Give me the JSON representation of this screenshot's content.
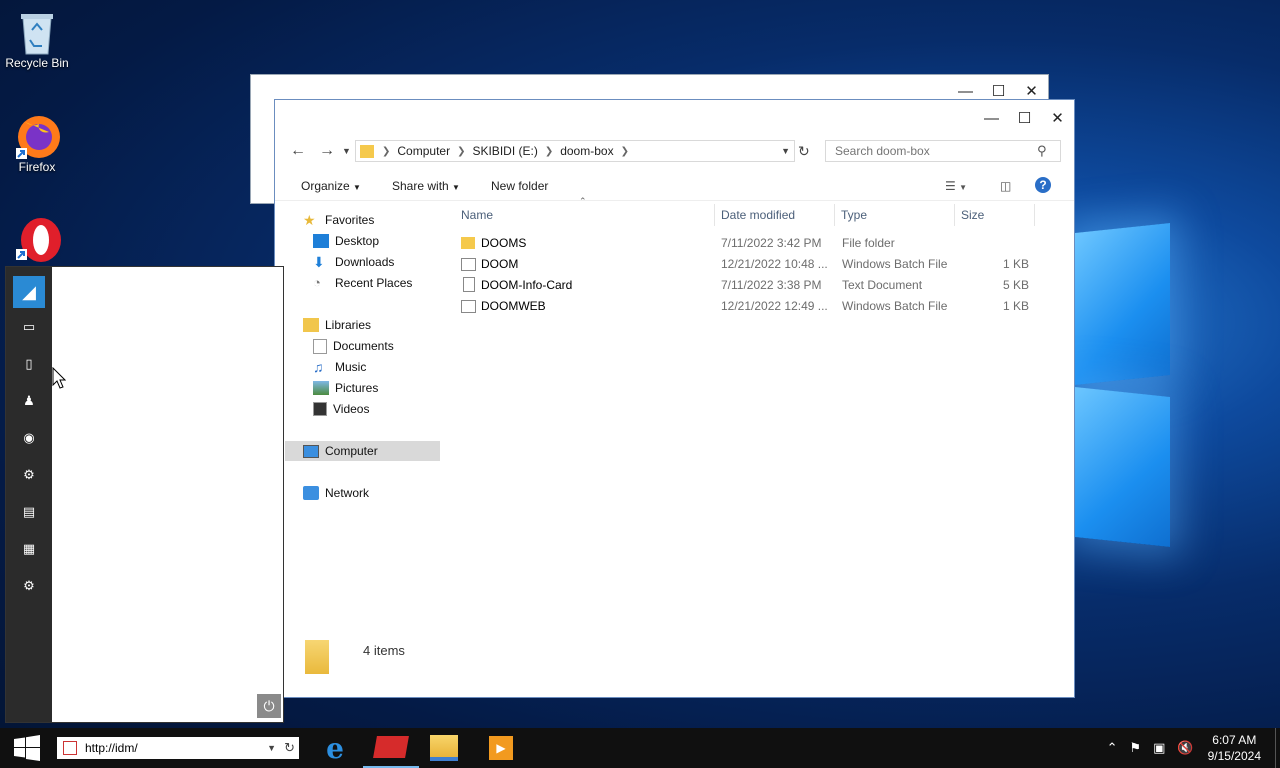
{
  "desktop": {
    "icons": [
      {
        "label": "Recycle Bin",
        "icon": "recycle-bin-icon"
      },
      {
        "label": "Firefox",
        "icon": "firefox-icon"
      },
      {
        "label": "",
        "icon": "opera-icon"
      }
    ]
  },
  "explorer": {
    "address": {
      "crumbs": [
        "Computer",
        "SKIBIDI (E:)",
        "doom-box"
      ]
    },
    "search_placeholder": "Search doom-box",
    "toolbar": {
      "organize": "Organize",
      "share_with": "Share with",
      "new_folder": "New folder"
    },
    "nav": {
      "favorites": "Favorites",
      "desktop": "Desktop",
      "downloads": "Downloads",
      "recent_places": "Recent Places",
      "libraries": "Libraries",
      "documents": "Documents",
      "music": "Music",
      "pictures": "Pictures",
      "videos": "Videos",
      "computer": "Computer",
      "network": "Network"
    },
    "columns": {
      "name": "Name",
      "date": "Date modified",
      "type": "Type",
      "size": "Size"
    },
    "files": [
      {
        "name": "DOOMS",
        "date": "7/11/2022 3:42 PM",
        "type": "File folder",
        "size": "",
        "icon": "folder-icon"
      },
      {
        "name": "DOOM",
        "date": "12/21/2022 10:48 ...",
        "type": "Windows Batch File",
        "size": "1 KB",
        "icon": "batch-file-icon"
      },
      {
        "name": "DOOM-Info-Card",
        "date": "7/11/2022 3:38 PM",
        "type": "Text Document",
        "size": "5 KB",
        "icon": "text-file-icon"
      },
      {
        "name": "DOOMWEB",
        "date": "12/21/2022 12:49 ...",
        "type": "Windows Batch File",
        "size": "1 KB",
        "icon": "batch-file-icon"
      }
    ],
    "status": "4 items"
  },
  "taskbar": {
    "address_value": "http://idm/",
    "clock_time": "6:07 AM",
    "clock_date": "9/15/2024"
  }
}
